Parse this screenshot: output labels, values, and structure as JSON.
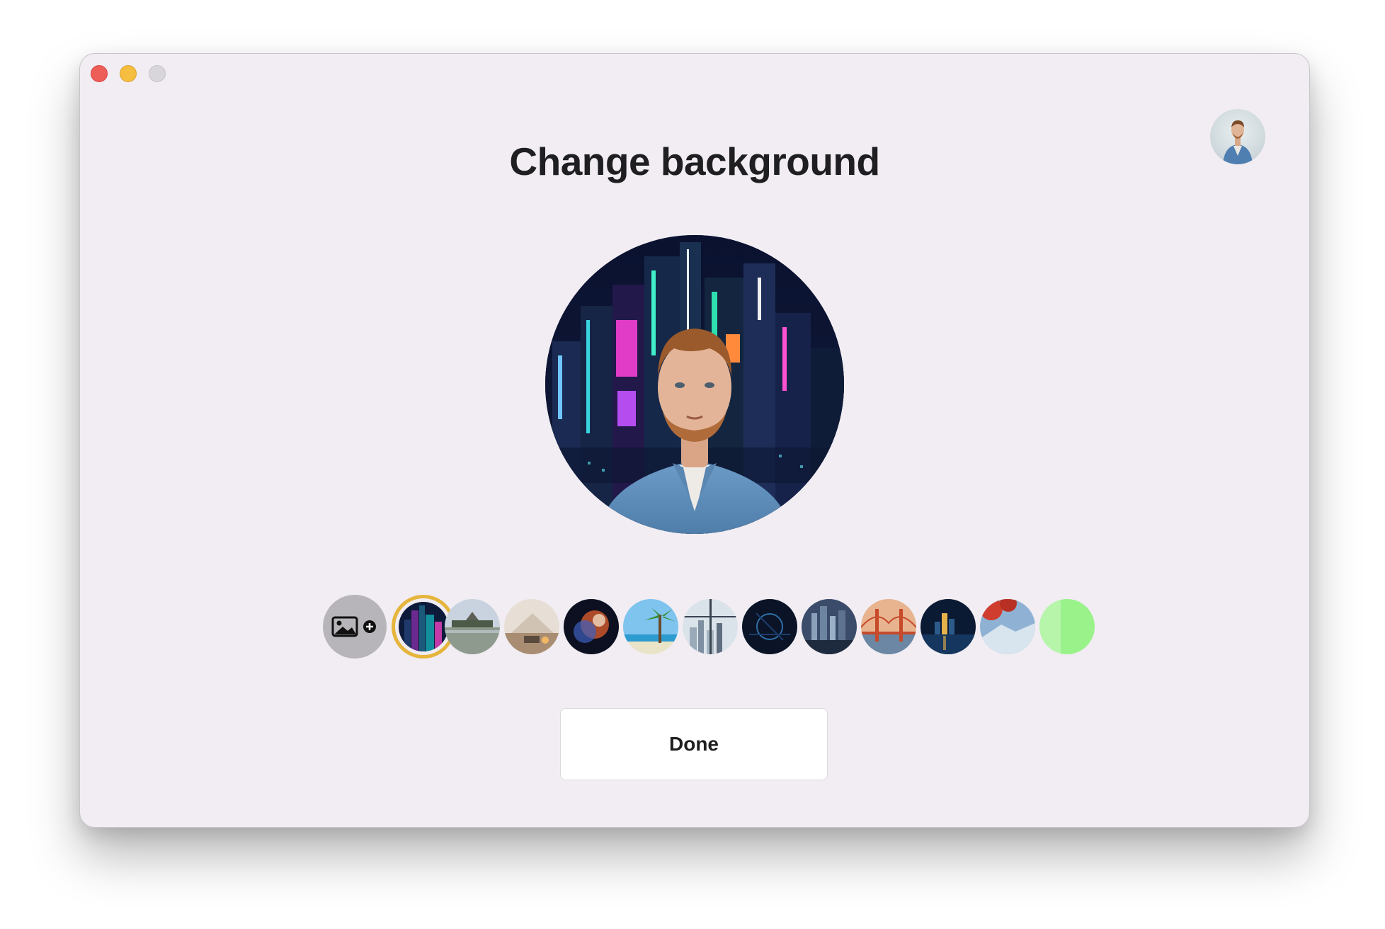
{
  "window": {
    "controls": [
      "close",
      "minimize",
      "maximize"
    ]
  },
  "header": {
    "title": "Change background",
    "avatar_icon": "user-avatar-icon"
  },
  "preview": {
    "icon": "person-on-city-background"
  },
  "backgrounds": {
    "add_icon": "add-image-icon",
    "selected_index": 0,
    "items": [
      {
        "name": "neon-city-night",
        "colors": [
          "#0d1a3a",
          "#6a2a8f",
          "#16c0c8"
        ]
      },
      {
        "name": "pagoda-lake",
        "colors": [
          "#c9d3e0",
          "#8a9a8a",
          "#5c5f55"
        ]
      },
      {
        "name": "modern-interior",
        "colors": [
          "#e7dfd6",
          "#a98d72",
          "#5a4a3e"
        ]
      },
      {
        "name": "nebula-space",
        "colors": [
          "#0c1020",
          "#c9552b",
          "#3d5fbf"
        ]
      },
      {
        "name": "tropical-beach",
        "colors": [
          "#7fc4ef",
          "#3a8f3a",
          "#e9e4c8"
        ]
      },
      {
        "name": "office-skyline-window",
        "colors": [
          "#dbe3ea",
          "#9aaab8",
          "#5f6f80"
        ]
      },
      {
        "name": "digital-grid",
        "colors": [
          "#0a1426",
          "#1c3c6e",
          "#2e6fa6"
        ]
      },
      {
        "name": "city-river-night",
        "colors": [
          "#3a4c6a",
          "#8aa0b8",
          "#1e2a3e"
        ]
      },
      {
        "name": "golden-gate-sunset",
        "colors": [
          "#e7b48f",
          "#c74a2a",
          "#6b87a3"
        ]
      },
      {
        "name": "skyline-water-night",
        "colors": [
          "#0b1a33",
          "#e6b24a",
          "#2c5a8a"
        ]
      },
      {
        "name": "red-tree-mountain",
        "colors": [
          "#cf3d2e",
          "#8fb2d4",
          "#d8e4ee"
        ]
      },
      {
        "name": "green-screen",
        "colors": [
          "#9af28a",
          "#6ee05c",
          "#c9f7c0"
        ]
      }
    ]
  },
  "actions": {
    "done_label": "Done"
  }
}
